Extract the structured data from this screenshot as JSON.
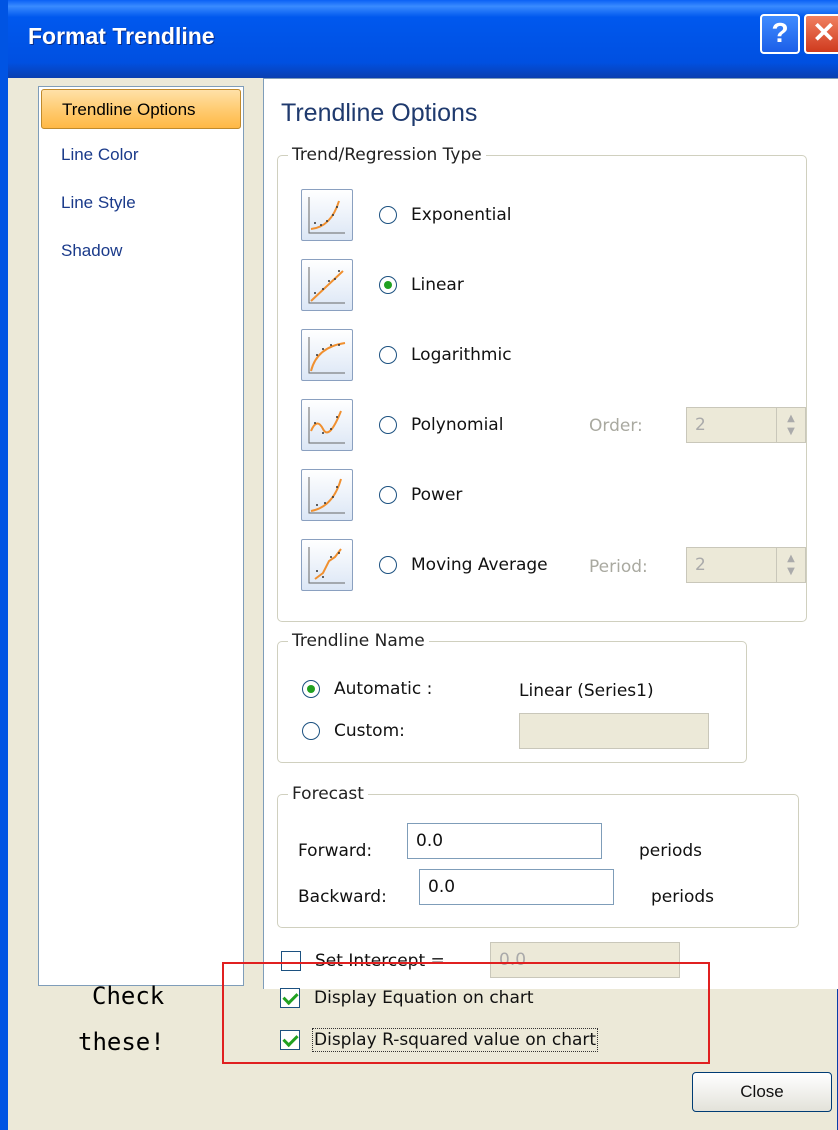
{
  "window": {
    "title": "Format Trendline",
    "help_button": "?",
    "close_glyph": "✕"
  },
  "nav": {
    "items": [
      "Trendline Options",
      "Line Color",
      "Line Style",
      "Shadow"
    ],
    "active": "Trendline Options"
  },
  "panel": {
    "title": "Trendline Options",
    "regression": {
      "legend": "Trend/Regression Type",
      "options": [
        {
          "label": "Exponential",
          "icon": "exponential-chart-icon",
          "selected": false
        },
        {
          "label": "Linear",
          "icon": "linear-chart-icon",
          "selected": true
        },
        {
          "label": "Logarithmic",
          "icon": "logarithmic-chart-icon",
          "selected": false
        },
        {
          "label": "Polynomial",
          "icon": "polynomial-chart-icon",
          "selected": false
        },
        {
          "label": "Power",
          "icon": "power-chart-icon",
          "selected": false
        },
        {
          "label": "Moving Average",
          "icon": "moving-average-chart-icon",
          "selected": false
        }
      ],
      "order_label": "Order:",
      "order_value": "2",
      "period_label": "Period:",
      "period_value": "2"
    },
    "name": {
      "legend": "Trendline Name",
      "automatic_label": "Automatic :",
      "automatic_value": "Linear (Series1)",
      "custom_label": "Custom:",
      "custom_value": ""
    },
    "forecast": {
      "legend": "Forecast",
      "forward_label": "Forward:",
      "forward_value": "0.0",
      "backward_label": "Backward:",
      "backward_value": "0.0",
      "periods_label": "periods"
    },
    "set_intercept": {
      "label": "Set Intercept =",
      "value": "0.0",
      "checked": false
    },
    "display_equation": {
      "label": "Display Equation on chart",
      "checked": true
    },
    "display_r2": {
      "label": "Display R-squared value on chart",
      "checked": true
    }
  },
  "footer": {
    "close_label": "Close"
  },
  "annotation": {
    "line1": "Check",
    "line2": "these!",
    "box_color": "#e02020"
  },
  "colors": {
    "titlebar": "#0054e3",
    "accent_green": "#21a121",
    "active_nav": "#ffcc73"
  }
}
